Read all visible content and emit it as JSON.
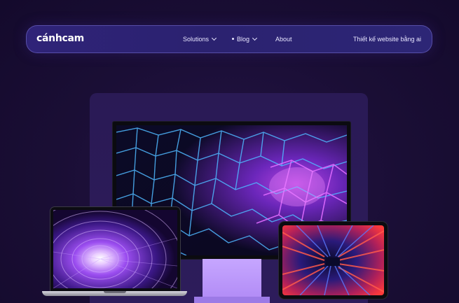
{
  "brand": {
    "logo_text": "cánhcam"
  },
  "nav": {
    "items": [
      {
        "label": "Solutions"
      },
      {
        "label": "Blog"
      },
      {
        "label": "About"
      }
    ],
    "cta_label": "Thiết kế website bằng ai"
  },
  "icons": {
    "solutions_dropdown": "chevron-down-icon",
    "blog_dropdown": "chevron-down-icon",
    "blog_marker": "dot-icon"
  },
  "colors": {
    "background": "#1a0e35",
    "navbar": "#2d2475",
    "navbar_border": "#8c82e6",
    "accent_purple": "#b28cf6",
    "text": "#ffffff"
  },
  "hero": {
    "devices": [
      "monitor",
      "laptop",
      "tablet"
    ]
  }
}
